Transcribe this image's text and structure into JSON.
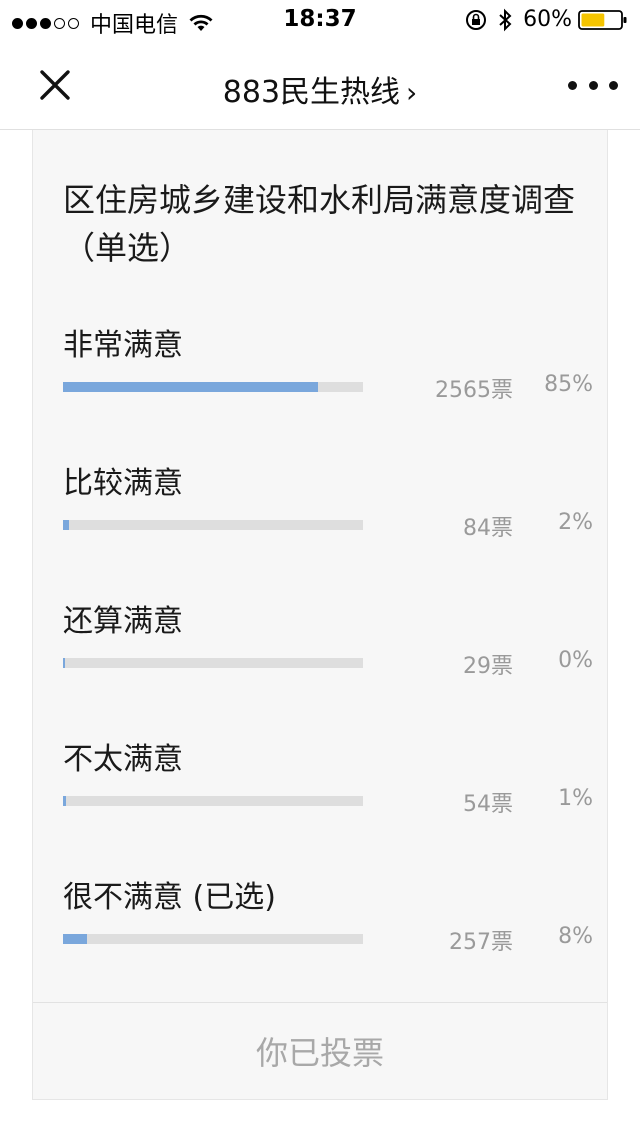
{
  "status_bar": {
    "carrier": "中国电信",
    "time": "18:37",
    "battery_percent": "60%",
    "battery_level": 0.6,
    "battery_color": "#f5c400",
    "signal_dots_filled": 3,
    "signal_dots_total": 5
  },
  "nav": {
    "title": "883民生热线",
    "chevron": "›",
    "close_icon": "close-icon",
    "more_icon": "more-icon"
  },
  "survey": {
    "question": "区住房城乡建设和水利局满意度调查（单选）",
    "bar_color": "#7aa7dc",
    "track_color": "#dedede",
    "options": [
      {
        "label": "非常满意",
        "votes": "2565票",
        "percent": "85%",
        "fill": 0.85
      },
      {
        "label": "比较满意",
        "votes": "84票",
        "percent": "2%",
        "fill": 0.02
      },
      {
        "label": "还算满意",
        "votes": "29票",
        "percent": "0%",
        "fill": 0.0
      },
      {
        "label": "不太满意",
        "votes": "54票",
        "percent": "1%",
        "fill": 0.01
      },
      {
        "label": "很不满意 (已选)",
        "votes": "257票",
        "percent": "8%",
        "fill": 0.08
      }
    ],
    "voted_label": "你已投票"
  }
}
